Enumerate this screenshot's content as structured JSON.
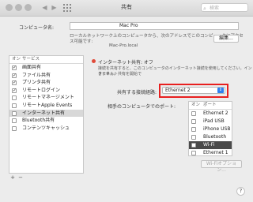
{
  "window": {
    "title": "共有",
    "search_placeholder": "検索"
  },
  "computer": {
    "label": "コンピュータ名:",
    "value": "Mac Pro",
    "info_line1": "ローカルネットワーク上のコンピュータから、次のアドレスでこのコンピュータにアクセ",
    "info_line2": "ス可能です:",
    "address": "Mac-Pro.local",
    "edit_button": "編集..."
  },
  "services": {
    "header_on": "オン",
    "header_service": "サービス",
    "items": [
      {
        "label": "画面共有",
        "checked": true
      },
      {
        "label": "ファイル共有",
        "checked": true
      },
      {
        "label": "プリンタ共有",
        "checked": true
      },
      {
        "label": "リモートログイン",
        "checked": true
      },
      {
        "label": "リモートマネージメント",
        "checked": false
      },
      {
        "label": "リモートApple Events",
        "checked": false
      },
      {
        "label": "インターネット共有",
        "checked": false
      },
      {
        "label": "Bluetooth共有",
        "checked": false
      },
      {
        "label": "コンテンツキャッシュ",
        "checked": false
      }
    ],
    "selected_index": 6
  },
  "detail": {
    "status": "インターネット共有: オフ",
    "description_line1": "接続を共有すると、このコンピュータのインターネット接続を使用してください。インターネット共有を開始で",
    "description_line2": "きません。",
    "share_from_label": "共有する接続経路:",
    "share_from_value": "Ethernet 2",
    "to_computers_label": "相手のコンピュータでのポート:",
    "ports_header_on": "オン",
    "ports_header_port": "ポート",
    "ports": [
      "Ethernet 2",
      "iPad USB",
      "iPhone USB",
      "Bluetooth PAN",
      "Wi-Fi",
      "Ethernet 1"
    ],
    "selected_port_index": 4,
    "wifi_options_button": "Wi-Fiオプション..."
  },
  "help": "?",
  "colors": {
    "highlight": "#e81f1f",
    "status_off": "#e04a3a",
    "accent": "#2f7ff0"
  }
}
